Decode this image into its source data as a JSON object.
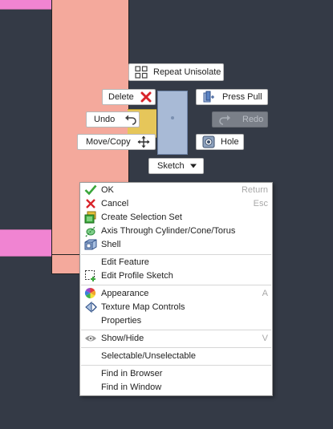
{
  "marking_menu": {
    "repeat_unisolate": "Repeat Unisolate",
    "delete": "Delete",
    "press_pull": "Press Pull",
    "undo": "Undo",
    "redo": "Redo",
    "move_copy": "Move/Copy",
    "hole": "Hole",
    "sketch": "Sketch"
  },
  "context_menu": {
    "ok": {
      "label": "OK",
      "shortcut": "Return"
    },
    "cancel": {
      "label": "Cancel",
      "shortcut": "Esc"
    },
    "create_selection_set": {
      "label": "Create Selection Set"
    },
    "axis_through": {
      "label": "Axis Through Cylinder/Cone/Torus"
    },
    "shell": {
      "label": "Shell"
    },
    "edit_feature": {
      "label": "Edit Feature"
    },
    "edit_profile_sketch": {
      "label": "Edit Profile Sketch"
    },
    "appearance": {
      "label": "Appearance",
      "shortcut": "A"
    },
    "texture_map_controls": {
      "label": "Texture Map Controls"
    },
    "properties": {
      "label": "Properties"
    },
    "show_hide": {
      "label": "Show/Hide",
      "shortcut": "V"
    },
    "selectable": {
      "label": "Selectable/Unselectable"
    },
    "find_in_browser": {
      "label": "Find in Browser"
    },
    "find_in_window": {
      "label": "Find in Window"
    }
  },
  "colors": {
    "background": "#343a46",
    "body_salmon": "#f4a99c",
    "pink_bar": "#f084d2",
    "selected_face": "#a8bad6",
    "accent_green": "#3aa63a",
    "delete_red": "#d9232a"
  }
}
